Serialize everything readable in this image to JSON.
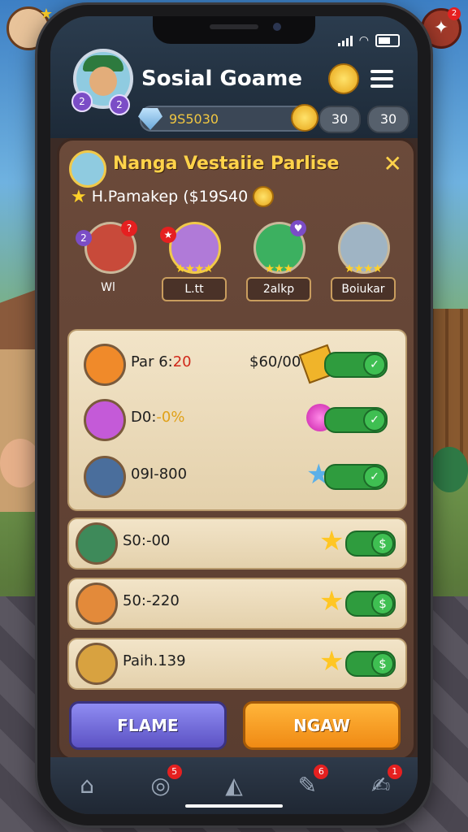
{
  "app": {
    "title": "Sosial Goame",
    "resource_value": "9S5030",
    "pill_a": "30",
    "pill_b": "30",
    "main_avatar_badges": [
      "2",
      "2"
    ]
  },
  "panel": {
    "title": "Nanga Vestaiie Parlise",
    "subtitle": "H.Pamakep ($19S40",
    "close_label": "✕"
  },
  "friends": [
    {
      "name": "Wl",
      "color": "#c84a3a",
      "tag": "?",
      "tag_color": "#e52020"
    },
    {
      "name": "L.tt",
      "color": "#b07ad8",
      "tag": "★",
      "tag_color": "#e52020"
    },
    {
      "name": "2alkp",
      "color": "#3cb060",
      "tag": "♥",
      "tag_color": "#7b4dc6"
    },
    {
      "name": "Boiukar",
      "color": "#9fb4c4",
      "tag": "",
      "tag_color": ""
    }
  ],
  "rows": [
    {
      "text_a": "Par 6:",
      "text_b": "20",
      "amount": "$60/00",
      "color": "#f08a2a"
    },
    {
      "text_a": "D0:",
      "text_b": "-0%",
      "amount": "",
      "color": "#c45ad8"
    },
    {
      "text_a": "09I-800",
      "text_b": "",
      "amount": "",
      "color": "#4a6e9c"
    },
    {
      "text_a": "S0:-00",
      "text_b": "",
      "amount": "",
      "color": "#3e8a5a"
    },
    {
      "text_a": "50:-220",
      "text_b": "",
      "amount": "",
      "color": "#e38a3a"
    },
    {
      "text_a": "Paih.139",
      "text_b": "",
      "amount": "",
      "color": "#d8a240"
    }
  ],
  "buttons": {
    "flame": "FLAME",
    "ngaw": "NGAW"
  },
  "tabs": [
    {
      "icon": "home-icon",
      "badge": ""
    },
    {
      "icon": "radar-icon",
      "badge": "5"
    },
    {
      "icon": "map-icon",
      "badge": ""
    },
    {
      "icon": "tools-icon",
      "badge": "6"
    },
    {
      "icon": "edit-icon",
      "badge": "1"
    }
  ],
  "corner_badge": "2"
}
